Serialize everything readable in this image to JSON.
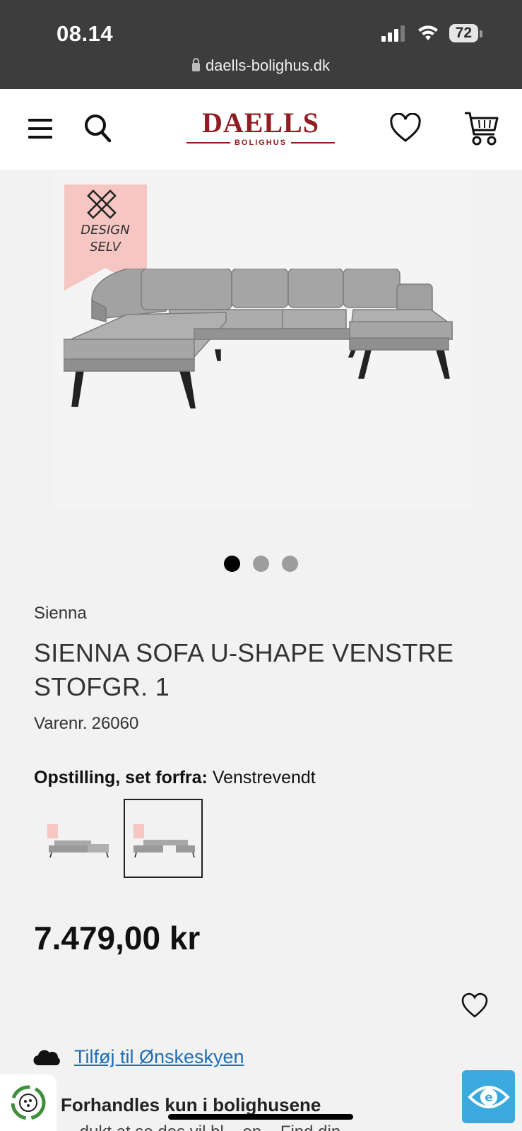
{
  "status_bar": {
    "time": "08.14",
    "battery": "72",
    "url": "daells-bolighus.dk"
  },
  "header": {
    "logo_main": "DAELLS",
    "logo_sub": "BOLIGHUS",
    "brand_color": "#8f1d21",
    "icons": [
      "menu-icon",
      "search-icon",
      "heart-icon",
      "cart-icon"
    ]
  },
  "gallery": {
    "badge_text_line1": "DESIGN",
    "badge_text_line2": "SELV",
    "badge_color": "#f5c6c2",
    "slide_count": 3,
    "active_slide": 1
  },
  "product": {
    "brand": "Sienna",
    "title": "SIENNA SOFA U-SHAPE VENSTRE STOFGR. 1",
    "sku_label": "Varenr.",
    "sku_value": "26060",
    "option_label": "Opstilling, set forfra:",
    "option_value": "Venstrevendt",
    "variants_selected_index": 1,
    "price": "7.479,00 kr"
  },
  "wishlist": {
    "cloud_link": "Tilføj til Ønskeskyen",
    "link_color": "#1f6fb8"
  },
  "footer_info": {
    "headline": "Forhandles kun i bolighusene",
    "subline": "... dukt at se des vil bl... en... Find din..."
  }
}
